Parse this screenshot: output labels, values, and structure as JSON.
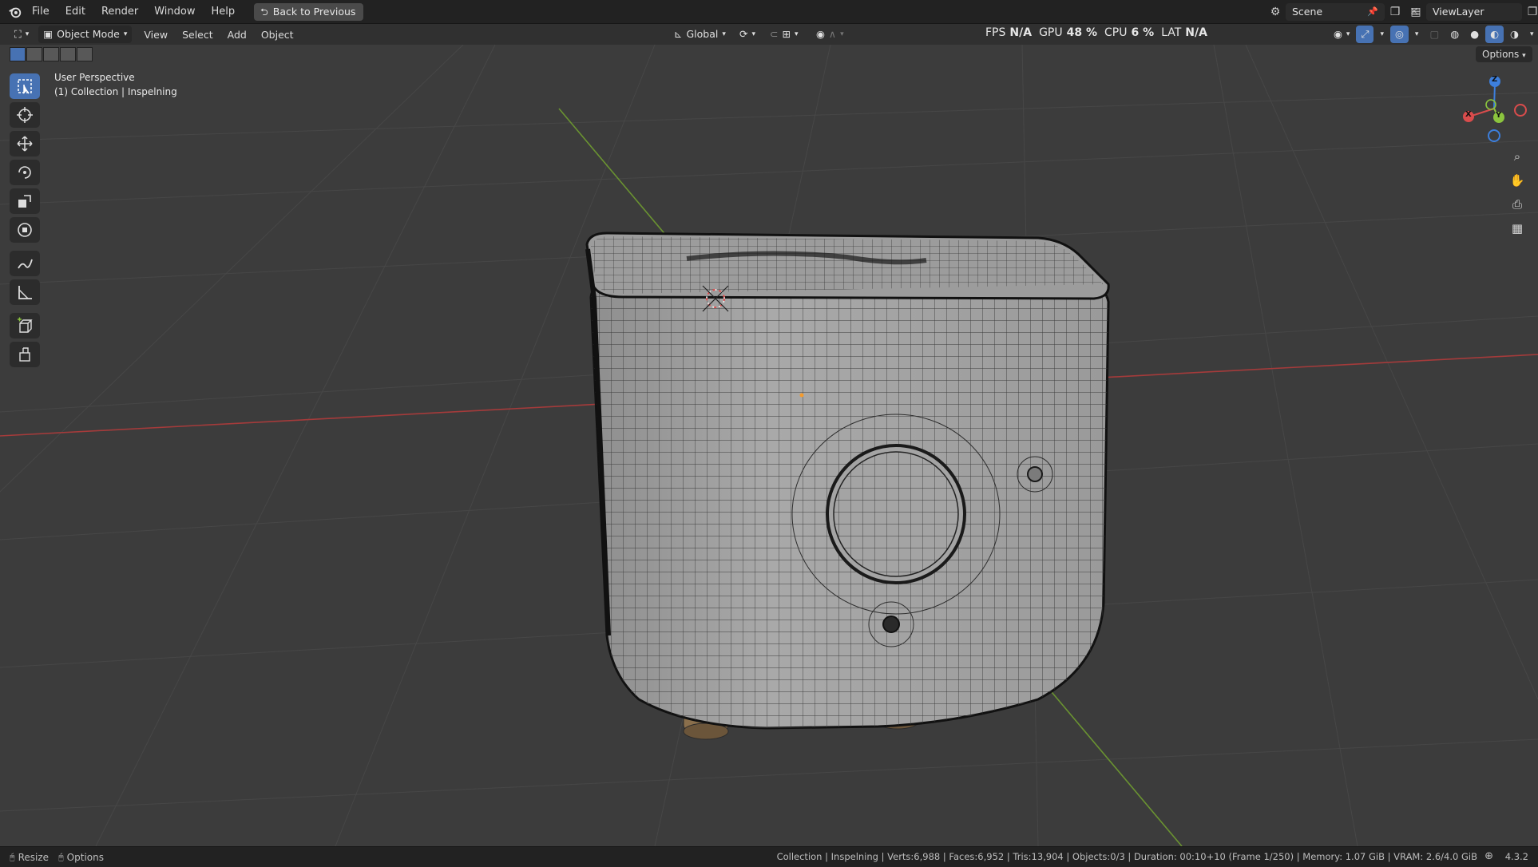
{
  "topbar": {
    "menus": [
      "File",
      "Edit",
      "Render",
      "Window",
      "Help"
    ],
    "back_button": "Back to Previous",
    "scene": "Scene",
    "view_layer": "ViewLayer"
  },
  "header": {
    "mode": "Object Mode",
    "menus": [
      "View",
      "Select",
      "Add",
      "Object"
    ],
    "transform_orientation": "Global",
    "stats": {
      "fps_label": "FPS",
      "fps_value": "N/A",
      "gpu_label": "GPU",
      "gpu_value": "48 %",
      "cpu_label": "CPU",
      "cpu_value": "6 %",
      "lat_label": "LAT",
      "lat_value": "N/A"
    },
    "options": "Options"
  },
  "viewport": {
    "perspective": "User Perspective",
    "collection": "(1) Collection | Inspelning",
    "gizmo_axes": {
      "z": "Z",
      "y": "Y",
      "x": "X"
    }
  },
  "toolbar": {
    "tools": [
      "select-box",
      "cursor",
      "move",
      "rotate",
      "scale",
      "transform",
      "annotate",
      "measure",
      "add-cube",
      "extrude"
    ],
    "active_tool": "select-box"
  },
  "statusbar": {
    "left": [
      "Resize",
      "Options"
    ],
    "info": "Collection | Inspelning | Verts:6,988 | Faces:6,952 | Tris:13,904 | Objects:0/3 | Duration: 00:10+10 (Frame 1/250) | Memory: 1.07 GiB | VRAM: 2.6/4.0 GiB",
    "version": "4.3.2"
  },
  "colors": {
    "accent": "#4772b3",
    "axis_x": "#d94c4c",
    "axis_y": "#8bc43e",
    "axis_z": "#3d7fdc",
    "grid_line": "#4d4d4d"
  }
}
